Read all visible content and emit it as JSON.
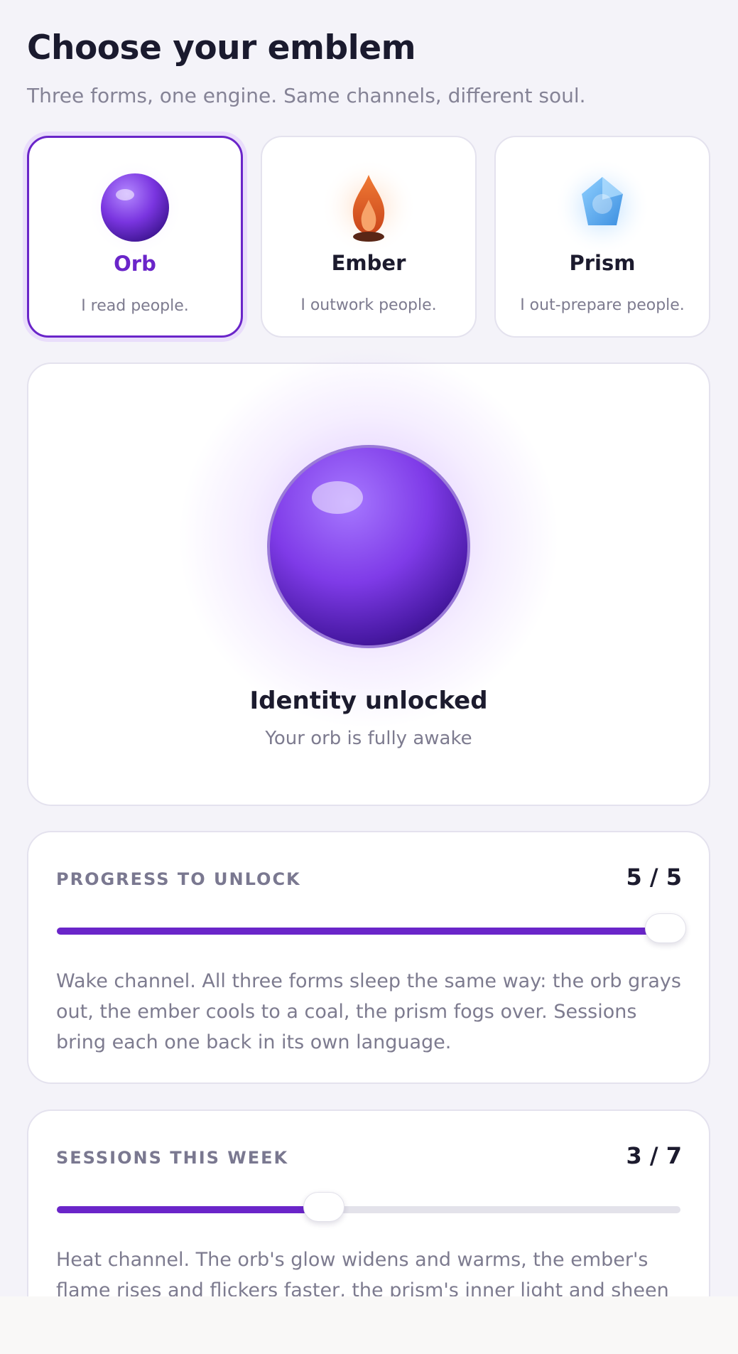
{
  "header": {
    "title": "Choose your emblem",
    "subtitle": "Three forms, one engine. Same channels, different soul."
  },
  "emblems": [
    {
      "name": "Orb",
      "tagline": "I read people.",
      "icon": "orb-icon",
      "selected": true,
      "color": "#6a25c9"
    },
    {
      "name": "Ember",
      "tagline": "I outwork people.",
      "icon": "flame-icon",
      "selected": false,
      "color": "#d9531e"
    },
    {
      "name": "Prism",
      "tagline": "I out-prepare people.",
      "icon": "crystal-icon",
      "selected": false,
      "color": "#4aa3ea"
    }
  ],
  "hero": {
    "icon": "orb-icon",
    "title": "Identity unlocked",
    "subtitle": "Your orb is fully awake"
  },
  "progress": {
    "label": "PROGRESS TO UNLOCK",
    "count_text": "5 / 5",
    "value": 5,
    "max": 5,
    "description": "Wake channel. All three forms sleep the same way: the orb grays out, the ember cools to a coal, the prism fogs over. Sessions bring each one back in its own language."
  },
  "sessions": {
    "label": "SESSIONS THIS WEEK",
    "count_text": "3 / 7",
    "value": 3,
    "max": 7,
    "description": "Heat channel. The orb's glow widens and warms, the ember's flame rises and flickers faster, the prism's inner light and sheen sharpen."
  },
  "colors": {
    "accent": "#6a25c9",
    "background": "#f4f3f9",
    "track": "#e3e2ea"
  }
}
